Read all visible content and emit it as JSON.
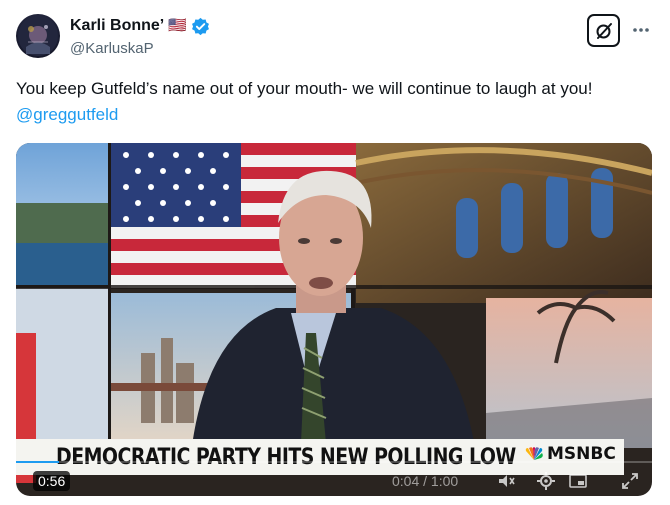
{
  "user": {
    "display_name": "Karli Bonne’",
    "handle": "@KarluskaP",
    "flag": "🇺🇸",
    "verified_color": "#1d9bf0"
  },
  "tweet": {
    "text": "You keep Gutfeld’s name out of your mouth- we will continue to laugh at you!",
    "mention": "@greggutfeld",
    "mention_color": "#1d9bf0"
  },
  "video": {
    "chyron": "DEMOCRATIC PARTY HITS NEW POLLING LOW",
    "network": "MSNBC",
    "duration_badge": "0:56",
    "time_readout": "0:04 / 1:00",
    "progress": 0.067
  },
  "icons": {
    "verified": "verified-badge-icon",
    "grok": "grok-icon",
    "more": "more-icon",
    "peacock": "peacock-icon",
    "volume": "volume-icon",
    "settings": "settings-icon",
    "pip": "picture-in-picture-icon",
    "fullscreen": "fullscreen-icon"
  }
}
